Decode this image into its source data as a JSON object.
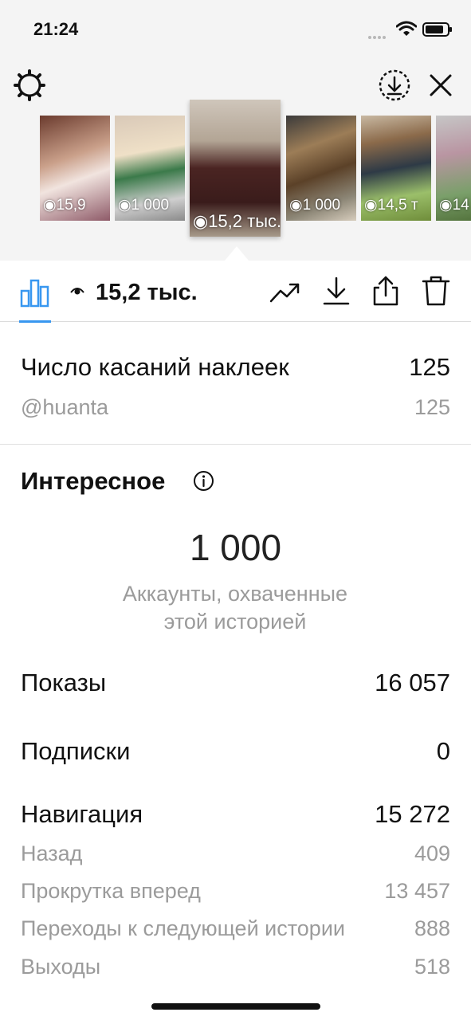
{
  "status_bar": {
    "time": "21:24"
  },
  "stories": [
    {
      "views": "15,9"
    },
    {
      "views": "1 000"
    },
    {
      "views": "15,2 тыс.",
      "selected": true
    },
    {
      "views": "1 000"
    },
    {
      "views": "14,5 т"
    },
    {
      "views": "14"
    }
  ],
  "toolbar": {
    "views": "15,2 тыс."
  },
  "sticker_taps": {
    "label": "Число касаний наклеек",
    "value": "125",
    "handle": "@huanta",
    "handle_value": "125"
  },
  "discovery": {
    "title": "Интересное",
    "reach_value": "1 000",
    "reach_caption_line1": "Аккаунты, охваченные",
    "reach_caption_line2": "этой историей"
  },
  "metrics": {
    "impressions": {
      "label": "Показы",
      "value": "16 057"
    },
    "follows": {
      "label": "Подписки",
      "value": "0"
    },
    "navigation": {
      "label": "Навигация",
      "value": "15 272"
    },
    "back": {
      "label": "Назад",
      "value": "409"
    },
    "forward": {
      "label": "Прокрутка вперед",
      "value": "13 457"
    },
    "next_story": {
      "label": "Переходы к следующей истории",
      "value": "888"
    },
    "exits": {
      "label": "Выходы",
      "value": "518"
    }
  },
  "colors": {
    "accent": "#3897f0",
    "muted": "#9b9b9b",
    "top_bg": "#f4f4f4"
  }
}
